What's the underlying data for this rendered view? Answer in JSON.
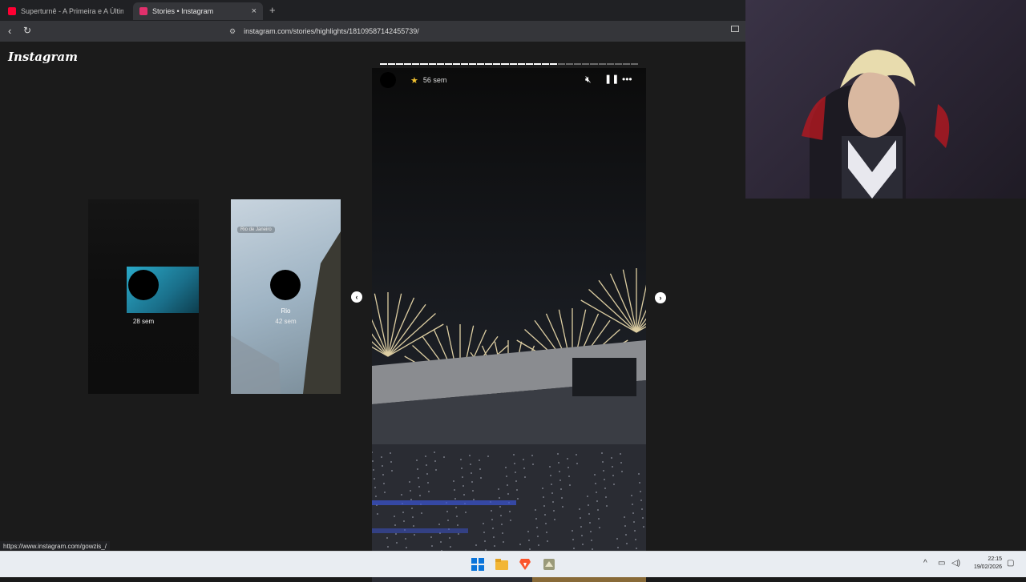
{
  "browser": {
    "tabs": [
      {
        "title": "Superturnê - A Primeira e A Última N",
        "favicon": "youtube-icon",
        "color": "#ff0033"
      },
      {
        "title": "Stories • Instagram",
        "favicon": "instagram-icon",
        "color": "#e1306c"
      }
    ],
    "close_label": "×",
    "new_tab_label": "+",
    "url": "instagram.com/stories/highlights/18109587142455739/"
  },
  "page": {
    "logo": "Instagram",
    "story": {
      "time": "56 sem",
      "progress": {
        "segments": 32,
        "current": 22
      }
    },
    "previews": [
      {
        "name": "",
        "time": "28 sem"
      },
      {
        "name": "Rio",
        "time": "42 sem",
        "location": "Rio de Janeiro"
      }
    ]
  },
  "status_url": "https://www.instagram.com/gowzis_/",
  "taskbar": {
    "icons": [
      "windows-start-icon",
      "file-explorer-icon",
      "brave-browser-icon",
      "app-icon"
    ],
    "clock_time": "22:15",
    "clock_date": "19/02/2026"
  },
  "colors": {
    "accent_star": "#f2c230",
    "page_bg": "#1b1b1b"
  }
}
